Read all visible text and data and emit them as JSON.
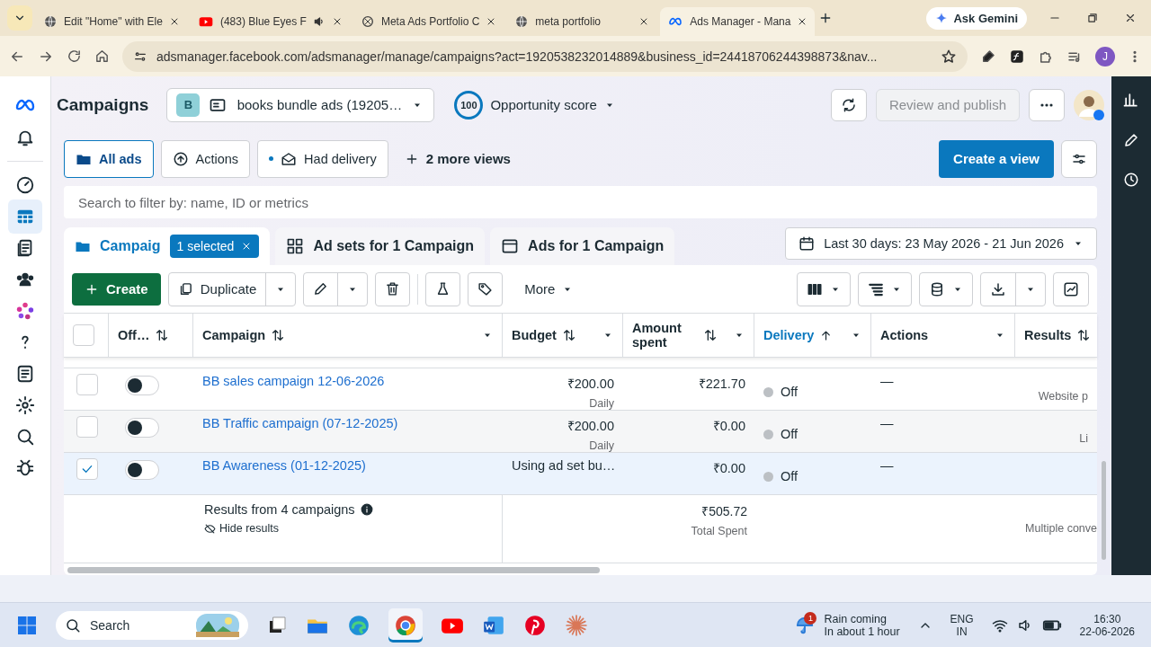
{
  "browser": {
    "tabs": [
      {
        "title": "Edit \"Home\" with Ele",
        "audio": false,
        "selected": false
      },
      {
        "title": "(483) Blue Eyes F",
        "audio": true,
        "selected": false
      },
      {
        "title": "Meta Ads Portfolio C",
        "audio": false,
        "selected": false
      },
      {
        "title": "meta portfolio",
        "audio": false,
        "selected": false
      },
      {
        "title": "Ads Manager - Mana",
        "audio": false,
        "selected": true
      }
    ],
    "gemini": "Ask Gemini",
    "url": "adsmanager.facebook.com/adsmanager/manage/campaigns?act=1920538232014889&business_id=24418706244398873&nav...",
    "profile": "J"
  },
  "header": {
    "title": "Campaigns",
    "account_badge": "B",
    "account": "books bundle ads (19205…",
    "score": "100",
    "score_label": "Opportunity score",
    "publish": {
      "label": "Review and publish",
      "disabled": true
    }
  },
  "views": [
    {
      "label": "All ads",
      "selected": true
    },
    {
      "label": "Actions",
      "selected": false
    },
    {
      "label": "Had delivery",
      "selected": false
    }
  ],
  "more_views": "2 more views",
  "create_view": "Create a view",
  "search": {
    "placeholder": "Search to filter by: name, ID or metrics"
  },
  "level_tabs": [
    {
      "label": "Campaig",
      "badge": "1 selected",
      "selected": true
    },
    {
      "label": "Ad sets for 1 Campaign",
      "selected": false
    },
    {
      "label": "Ads for 1 Campaign",
      "selected": false
    }
  ],
  "date_range": "Last 30 days: 23 May 2026 - 21 Jun 2026",
  "toolbar": {
    "create": "Create",
    "duplicate": "Duplicate",
    "more": "More"
  },
  "select_all": {
    "checked": false
  },
  "columns": [
    {
      "label": "Off…",
      "sorted": false
    },
    {
      "label": "Campaign",
      "sorted": false
    },
    {
      "label": "Budget",
      "sorted": false
    },
    {
      "label": "Amount spent",
      "sorted": false
    },
    {
      "label": "Delivery",
      "sorted": true
    },
    {
      "label": "Actions",
      "sorted": false
    },
    {
      "label": "Results",
      "sorted": false
    }
  ],
  "rows": [
    {
      "checked": false,
      "on": false,
      "name": "BB sales campaign 12-06-2026",
      "budget": "₹200.00",
      "budget_note": "Daily",
      "spent": "₹221.70",
      "delivery": "Off",
      "actions": "—",
      "results": "Website p"
    },
    {
      "checked": false,
      "on": false,
      "name": "BB Traffic campaign (07-12-2025)",
      "budget": "₹200.00",
      "budget_note": "Daily",
      "spent": "₹0.00",
      "delivery": "Off",
      "actions": "—",
      "results": "Li"
    },
    {
      "checked": true,
      "on": false,
      "name": "BB Awareness (01-12-2025)",
      "budget": "Using ad set bu…",
      "spent": "₹0.00",
      "delivery": "Off",
      "actions": "—"
    }
  ],
  "summary": {
    "label": "Results from 4 campaigns",
    "hide": "Hide results",
    "spent": "₹505.72",
    "spent_note": "Total Spent",
    "results_note": "Multiple conve"
  },
  "taskbar": {
    "search": "Search",
    "weather_badge": "1",
    "weather_title": "Rain coming",
    "weather_note": "In about 1 hour",
    "lang": "ENG",
    "region": "IN",
    "time": "16:30",
    "date": "22-06-2026"
  }
}
